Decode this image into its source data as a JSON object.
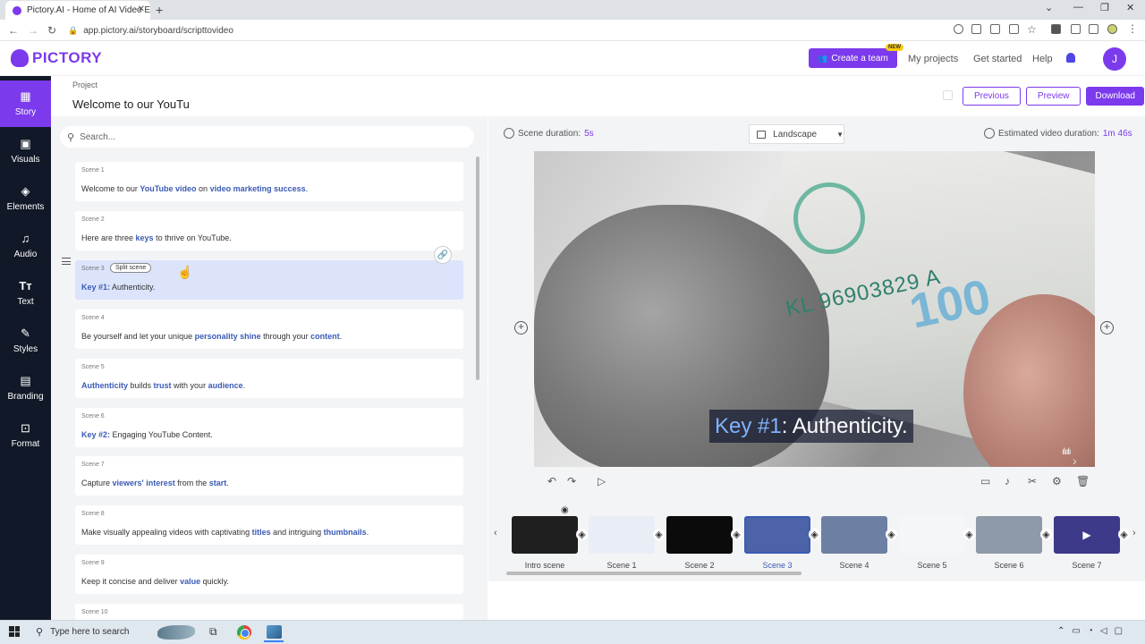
{
  "browser": {
    "tab_title": "Pictory.AI - Home of AI Video Ed",
    "url": "app.pictory.ai/storyboard/scripttovideo"
  },
  "header": {
    "logo": "PICTORY",
    "create_team": "Create a team",
    "new_badge": "NEW",
    "my_projects": "My projects",
    "get_started": "Get started",
    "help": "Help",
    "avatar": "J"
  },
  "sidebar": {
    "items": [
      {
        "label": "Story",
        "icon": "grid-icon"
      },
      {
        "label": "Visuals",
        "icon": "image-icon"
      },
      {
        "label": "Elements",
        "icon": "shapes-icon"
      },
      {
        "label": "Audio",
        "icon": "music-icon"
      },
      {
        "label": "Text",
        "icon": "text-icon"
      },
      {
        "label": "Styles",
        "icon": "styles-icon"
      },
      {
        "label": "Branding",
        "icon": "briefcase-icon"
      },
      {
        "label": "Format",
        "icon": "format-icon"
      }
    ]
  },
  "project": {
    "label": "Project",
    "title": "Welcome to our YouTu"
  },
  "actions": {
    "previous": "Previous",
    "preview": "Preview",
    "download": "Download"
  },
  "search": {
    "placeholder": "Search..."
  },
  "split_scene": "Split scene",
  "scenes": [
    {
      "label": "Scene 1"
    },
    {
      "label": "Scene 2"
    },
    {
      "label": "Scene 3"
    },
    {
      "label": "Scene 4"
    },
    {
      "label": "Scene 5"
    },
    {
      "label": "Scene 6"
    },
    {
      "label": "Scene 7"
    },
    {
      "label": "Scene 8"
    },
    {
      "label": "Scene 9"
    },
    {
      "label": "Scene 10"
    }
  ],
  "scene_text": {
    "s1": [
      "Welcome to our ",
      "YouTube video",
      " on ",
      "video marketing success",
      "."
    ],
    "s2": [
      "Here are three ",
      "keys",
      " to thrive on YouTube."
    ],
    "s3": [
      "Key #1:",
      " Authenticity."
    ],
    "s4": [
      "Be yourself and let your unique ",
      "personality shine",
      " through your ",
      "content",
      "."
    ],
    "s5": [
      "Authenticity",
      " builds ",
      "trust",
      " with your ",
      "audience",
      "."
    ],
    "s6": [
      "Key #2:",
      " Engaging YouTube Content."
    ],
    "s7": [
      "Capture ",
      "viewers' interest",
      " from the ",
      "start",
      "."
    ],
    "s8": [
      "Make visually appealing videos with captivating ",
      "titles",
      " and intriguing ",
      "thumbnails",
      "."
    ],
    "s9": [
      "Keep it concise and deliver ",
      "value",
      " quickly."
    ]
  },
  "preview": {
    "scene_duration_label": "Scene duration:",
    "scene_duration": "5s",
    "orientation": "Landscape",
    "est_duration_label": "Estimated video duration:",
    "est_duration": "1m 46s",
    "caption_hl": "Key #1",
    "caption_rest": ": Authenticity.",
    "serial": "KL 96903829 A",
    "big_number": "100"
  },
  "timeline": [
    {
      "label": "Intro scene",
      "color": "#1f1f1f"
    },
    {
      "label": "Scene 1",
      "color": "#e9eef6"
    },
    {
      "label": "Scene 2",
      "color": "#0b0b0b"
    },
    {
      "label": "Scene 3",
      "color": "#4c63a8"
    },
    {
      "label": "Scene 4",
      "color": "#6d7fa3"
    },
    {
      "label": "Scene 5",
      "color": "#f4f6fa"
    },
    {
      "label": "Scene 6",
      "color": "#8e9aa8"
    },
    {
      "label": "Scene 7",
      "color": "#3d3a8a"
    }
  ],
  "taskbar": {
    "search_placeholder": "Type here to search"
  },
  "colors": {
    "accent": "#7c3aed",
    "keyword": "#3b5bb5",
    "sidebar_bg": "#111827"
  }
}
